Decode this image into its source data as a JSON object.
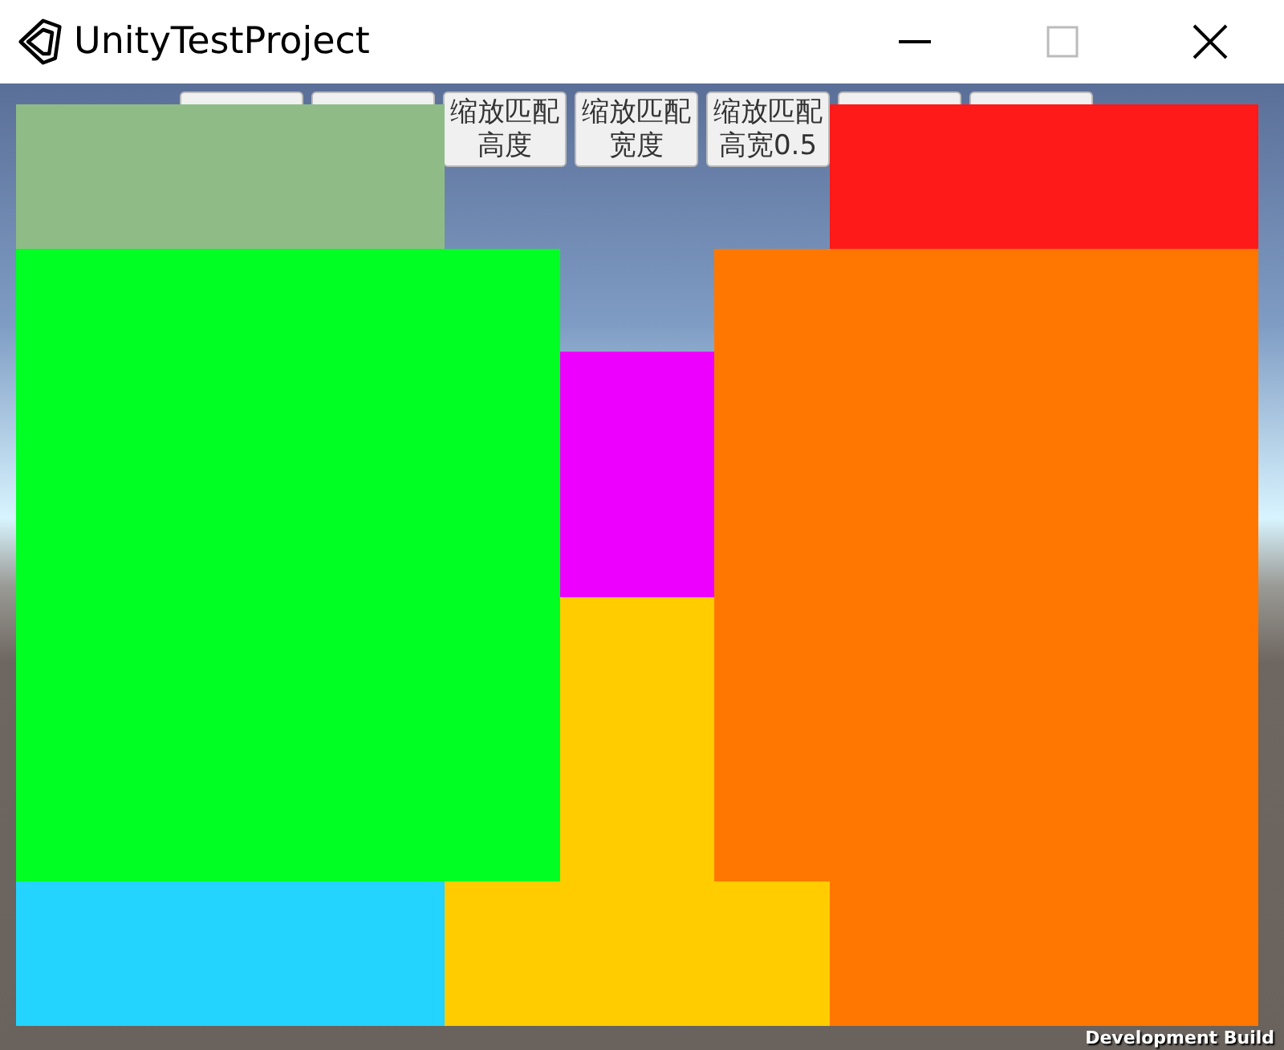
{
  "window": {
    "title": "UnityTestProject"
  },
  "buttons": [
    {
      "kind": "covered"
    },
    {
      "kind": "covered"
    },
    {
      "kind": "labelled",
      "lines": [
        "缩放匹配",
        "高度"
      ]
    },
    {
      "kind": "labelled",
      "lines": [
        "缩放匹配",
        "宽度"
      ]
    },
    {
      "kind": "labelled",
      "lines": [
        "缩放匹配",
        "高宽0.5"
      ]
    },
    {
      "kind": "covered"
    },
    {
      "kind": "covered"
    }
  ],
  "panels": [
    {
      "color": "#8fbc86"
    },
    {
      "color": "#ff1a1a"
    },
    {
      "color": "#00ff22"
    },
    {
      "color": "#ee00ff"
    },
    {
      "color": "#ffcc00"
    },
    {
      "color": "#ffcc00"
    },
    {
      "color": "#ff7700"
    },
    {
      "color": "#ff7700"
    },
    {
      "color": "#22d4ff"
    }
  ],
  "watermark_text": "Development Build"
}
